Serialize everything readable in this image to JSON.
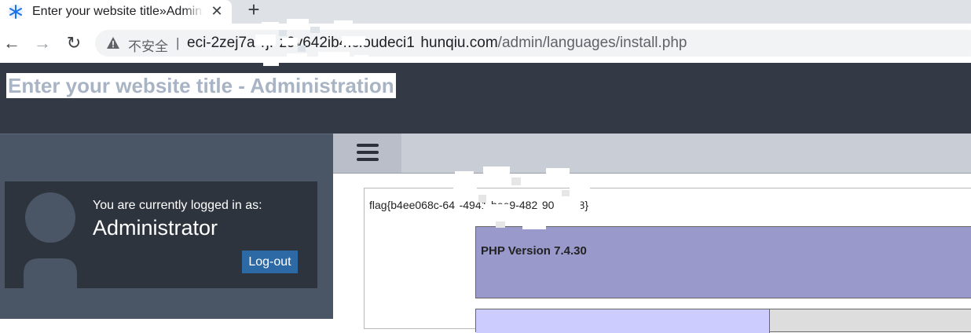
{
  "browser": {
    "tab": {
      "title": "Enter your website title»Administration",
      "favicon": "snowflake-favicon-icon",
      "close_icon": "close-icon"
    },
    "new_tab_icon": "plus-icon",
    "nav": {
      "back_icon": "arrow-left-icon",
      "forward_icon": "arrow-right-icon",
      "reload_icon": "reload-icon"
    },
    "address_bar": {
      "security_icon": "warning-triangle-icon",
      "security_label": "不安全",
      "separator": "|",
      "url_host": "eci-2zej7a  rj.  z9v642ib4.cloudeci1  hunqiu.com",
      "url_path": "/admin/languages/install.php"
    }
  },
  "site": {
    "title": "Enter your website title - Administration",
    "colors": {
      "header_bg": "#343a45",
      "sidebar_bg": "#4a5566",
      "title_text": "#a8b4c4",
      "logout_bg": "#2d6aa5",
      "php_header": "#9999cc"
    }
  },
  "sidebar": {
    "logged_label": "You are currently logged in as:",
    "user_name": "Administrator",
    "logout_label": "Log-out",
    "avatar_icon": "user-silhouette-icon"
  },
  "main": {
    "menu_icon": "hamburger-menu-icon",
    "flag": "flag{b4ee068c-64  -4941-bee9-482  905d198}",
    "php_version": "PHP Version 7.4.30"
  }
}
